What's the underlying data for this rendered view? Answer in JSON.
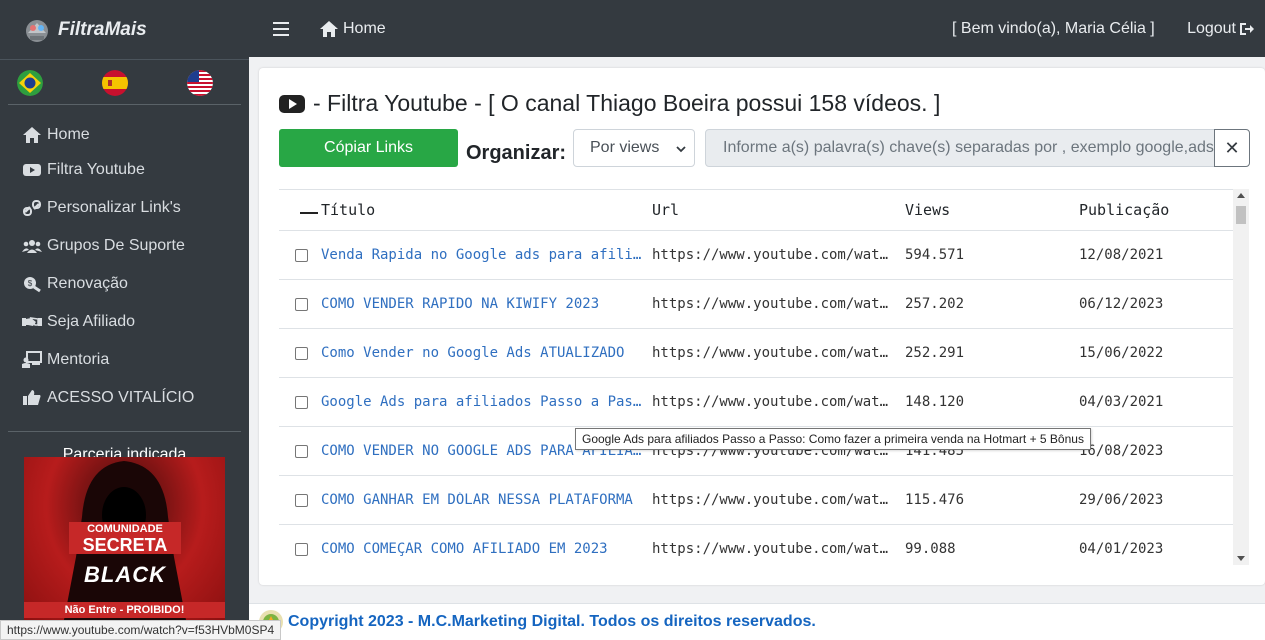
{
  "brand": {
    "name": "FiltraMais"
  },
  "languages": [
    {
      "name": "brazil-flag-icon"
    },
    {
      "name": "spain-flag-icon"
    },
    {
      "name": "usa-flag-icon"
    }
  ],
  "sidebar": {
    "items": [
      {
        "label": "Home",
        "icon": "home-icon"
      },
      {
        "label": "Filtra Youtube",
        "icon": "youtube-icon"
      },
      {
        "label": "Personalizar Link's",
        "icon": "link-icon"
      },
      {
        "label": "Grupos De Suporte",
        "icon": "users-icon"
      },
      {
        "label": "Renovação",
        "icon": "renew-icon"
      },
      {
        "label": "Seja Afiliado",
        "icon": "handshake-icon"
      },
      {
        "label": "Mentoria",
        "icon": "chalkboard-icon"
      },
      {
        "label": "ACESSO VITALÍCIO",
        "icon": "thumbs-up-icon"
      }
    ],
    "partner_title": "Parceria indicada",
    "partner_banner": {
      "line1": "COMUNIDADE",
      "line2": "SECRETA",
      "line3": "BLACK",
      "footer": "Não Entre - PROIBIDO!"
    }
  },
  "topbar": {
    "home_label": "Home",
    "welcome": "[ Bem vindo(a),  Maria Célia ]",
    "logout_label": "Logout"
  },
  "page": {
    "title": "- Filtra Youtube - [ O canal Thiago Boeira possui 158 vídeos. ]",
    "copy_button": "Cópiar Links",
    "organize_label": "Organizar:",
    "organize_selected": "Por views",
    "search_placeholder": "Informe a(s) palavra(s) chave(s) separadas por , exemplo google,ads",
    "clear_label": "✕"
  },
  "table": {
    "headers": {
      "title": "Título",
      "url": "Url",
      "views": "Views",
      "date": "Publicação"
    },
    "rows": [
      {
        "title": "Venda Rapida no Google ads para afiliados",
        "url": "https://www.youtube.com/watch",
        "views": "594.571",
        "date": "12/08/2021"
      },
      {
        "title": "COMO VENDER RAPIDO NA KIWIFY 2023",
        "url": "https://www.youtube.com/watch",
        "views": "257.202",
        "date": "06/12/2023"
      },
      {
        "title": "Como Vender no Google Ads ATUALIZADO",
        "url": "https://www.youtube.com/watch",
        "views": "252.291",
        "date": "15/06/2022"
      },
      {
        "title": "Google Ads para afiliados Passo a Passo",
        "url": "https://www.youtube.com/watch",
        "views": "148.120",
        "date": "04/03/2021"
      },
      {
        "title": "COMO VENDER NO GOOGLE ADS PARA AFILIADOS",
        "url": "https://www.youtube.com/watch",
        "views": "141.485",
        "date": "16/08/2023"
      },
      {
        "title": "COMO GANHAR EM DÓLAR NESSA PLATAFORMA",
        "url": "https://www.youtube.com/watch",
        "views": "115.476",
        "date": "29/06/2023"
      },
      {
        "title": "COMO COMEÇAR COMO AFILIADO EM 2023",
        "url": "https://www.youtube.com/watch",
        "views": "99.088",
        "date": "04/01/2023"
      }
    ]
  },
  "tooltip": "Google Ads para afiliados Passo a Passo: Como fazer a primeira venda na Hotmart + 5 Bônus",
  "footer": {
    "text": "Copyright 2023 - M.C.Marketing Digital. Todos os direitos reservados."
  },
  "statusbar": {
    "url": "https://www.youtube.com/watch?v=f53HVbM0SP4"
  }
}
